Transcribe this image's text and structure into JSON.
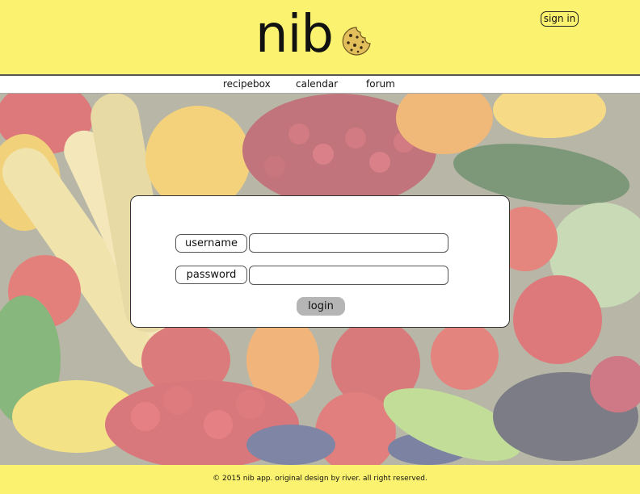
{
  "header": {
    "logo_text": "nib",
    "logo_icon": "cookie-icon",
    "sign_in_label": "sign in"
  },
  "nav": {
    "items": [
      {
        "label": "recipebox"
      },
      {
        "label": "calendar"
      },
      {
        "label": "forum"
      }
    ]
  },
  "login": {
    "username_label": "username",
    "username_value": "",
    "password_label": "password",
    "password_value": "",
    "login_label": "login"
  },
  "footer": {
    "text": "© 2015 nib app. original design by river. all right reserved."
  },
  "colors": {
    "brand_yellow": "#fbf36f",
    "login_button": "#b5b5b5"
  }
}
